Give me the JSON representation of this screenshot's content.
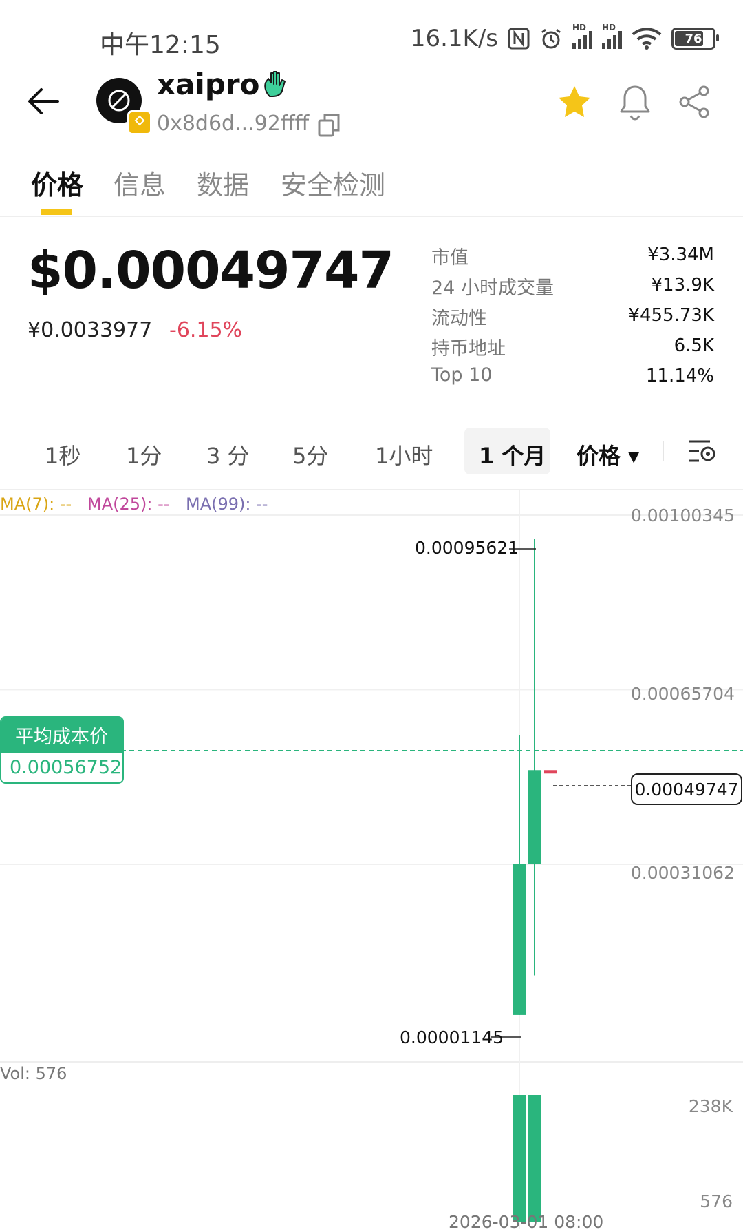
{
  "status_bar": {
    "time": "中午12:15",
    "speed": "16.1K/s",
    "battery": "76"
  },
  "header": {
    "name": "xaipro",
    "address": "0x8d6d...92ffff",
    "icons": [
      "back-arrow-icon",
      "coin-logo-icon",
      "chain-badge-icon",
      "waving-hand-icon",
      "copy-icon",
      "star-icon",
      "bell-icon",
      "share-icon"
    ],
    "star_color": "#f5c518"
  },
  "tabs": [
    {
      "label": "价格",
      "active": true
    },
    {
      "label": "信息",
      "active": false
    },
    {
      "label": "数据",
      "active": false
    },
    {
      "label": "安全检测",
      "active": false
    }
  ],
  "price": {
    "usd": "$0.00049747",
    "cny": "¥0.0033977",
    "change": "-6.15%",
    "change_color": "#e0455b"
  },
  "stats": [
    {
      "label": "市值",
      "value": "¥3.34M"
    },
    {
      "label": "24 小时成交量",
      "value": "¥13.9K"
    },
    {
      "label": "流动性",
      "value": "¥455.73K"
    },
    {
      "label": "持币地址",
      "value": "6.5K"
    },
    {
      "label": "Top 10",
      "value": "11.14%"
    }
  ],
  "timeframes": [
    {
      "label": "1秒",
      "active": false
    },
    {
      "label": "1分",
      "active": false
    },
    {
      "label": "3 分",
      "active": false
    },
    {
      "label": "5分",
      "active": false
    },
    {
      "label": "1小时",
      "active": false
    },
    {
      "label": "1 个月",
      "active": true
    }
  ],
  "price_toggle": "价格 ▾",
  "ma": [
    {
      "label": "MA(7): --",
      "color": "#d9a514"
    },
    {
      "label": "MA(25): --",
      "color": "#c0479b"
    },
    {
      "label": "MA(99): --",
      "color": "#7a6fb0"
    }
  ],
  "avg_cost": {
    "title": "平均成本价",
    "value": "0.00056752"
  },
  "current_price_label": "0.00049747",
  "high_label": "0.00095621",
  "low_label": "0.00001145",
  "volume": {
    "label": "Vol: 576",
    "ticks": [
      "238K",
      "576"
    ]
  },
  "date_label": "2026-03-01 08:00",
  "chart_data": {
    "type": "candlestick",
    "y_ticks": [
      "0.00100345",
      "0.00065704",
      "0.00031062"
    ],
    "ylim": [
      1.145e-05,
      0.00100345
    ],
    "x": [
      "2026-03-01 08:00"
    ],
    "series": [
      {
        "open": 0.00031062,
        "high": 0.00056752,
        "low": 1.145e-05,
        "close": 1.145e-05
      },
      {
        "open": 0.00049747,
        "high": 0.00095621,
        "low": 9e-05,
        "close": 0.00031062
      },
      {
        "open": 0.00049747,
        "high": 0.00049747,
        "low": 0.00049747,
        "close": 0.00049747
      }
    ],
    "volumes": [
      238000,
      238000,
      576
    ],
    "up_color": "#2ab57d",
    "down_color": "#e0455b"
  }
}
